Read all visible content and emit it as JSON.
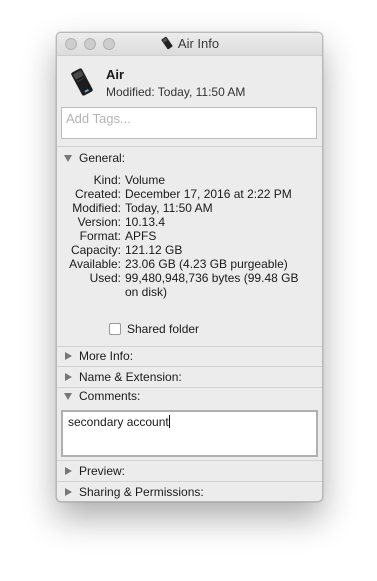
{
  "window": {
    "title": "Air Info"
  },
  "file": {
    "name": "Air",
    "modified": "Modified: Today, 11:50 AM"
  },
  "tags": {
    "placeholder": "Add Tags..."
  },
  "sections": {
    "general": "General:",
    "more_info": "More Info:",
    "name_extension": "Name & Extension:",
    "comments": "Comments:",
    "preview": "Preview:",
    "sharing": "Sharing & Permissions:"
  },
  "general": {
    "rows": [
      {
        "label": "Kind:",
        "value": "Volume"
      },
      {
        "label": "Created:",
        "value": "December 17, 2016 at 2:22 PM"
      },
      {
        "label": "Modified:",
        "value": "Today, 11:50 AM"
      },
      {
        "label": "Version:",
        "value": "10.13.4"
      },
      {
        "label": "Format:",
        "value": "APFS"
      },
      {
        "label": "Capacity:",
        "value": "121.12 GB"
      },
      {
        "label": "Available:",
        "value": "23.06 GB (4.23 GB purgeable)"
      },
      {
        "label": "Used:",
        "value": "99,480,948,736 bytes (99.48 GB",
        "value2": "on disk)"
      }
    ],
    "shared_folder": {
      "label": "Shared folder",
      "checked": false
    }
  },
  "comments": {
    "text": "secondary account"
  },
  "icons": {
    "volume": "external-drive-icon",
    "disclosure": "disclosure-triangle-icon"
  },
  "colors": {
    "window_bg": "#ececec",
    "field_bg": "#ffffff",
    "placeholder": "#b4b4b4"
  }
}
